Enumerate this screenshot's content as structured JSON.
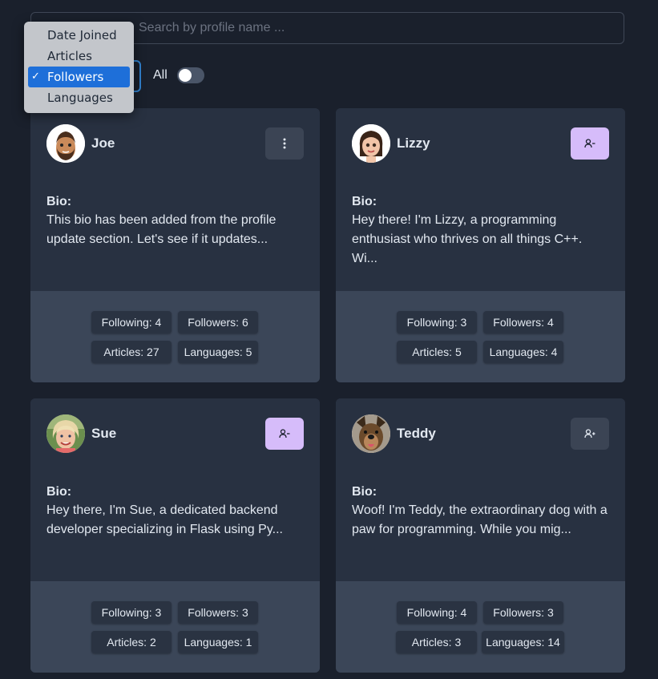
{
  "search": {
    "placeholder": "Search by profile name ...",
    "value": ""
  },
  "sort": {
    "options": [
      "Date Joined",
      "Articles",
      "Followers",
      "Languages"
    ],
    "selected_check": "✓"
  },
  "filter": {
    "toggle_label": "All"
  },
  "cards": [
    {
      "name": "Joe",
      "action": "menu",
      "bio_label": "Bio:",
      "bio": "This bio has been added from the profile update section. Let's see if it updates...",
      "following": "Following: 4",
      "followers": "Followers: 6",
      "articles": "Articles: 27",
      "languages": "Languages: 5"
    },
    {
      "name": "Lizzy",
      "action": "unfollow",
      "bio_label": "Bio:",
      "bio": "Hey there! I'm Lizzy, a programming enthusiast who thrives on all things C++. Wi...",
      "following": "Following: 3",
      "followers": "Followers: 4",
      "articles": "Articles: 5",
      "languages": "Languages: 4"
    },
    {
      "name": "Sue",
      "action": "unfollow",
      "bio_label": "Bio:",
      "bio": "Hey there, I'm Sue, a dedicated backend developer specializing in Flask using Py...",
      "following": "Following: 3",
      "followers": "Followers: 3",
      "articles": "Articles: 2",
      "languages": "Languages: 1"
    },
    {
      "name": "Teddy",
      "action": "follow",
      "bio_label": "Bio:",
      "bio": "Woof! I'm Teddy, the extraordinary dog with a paw for programming. While you mig...",
      "following": "Following: 4",
      "followers": "Followers: 3",
      "articles": "Articles: 3",
      "languages": "Languages: 14"
    }
  ],
  "colors": {
    "background": "#1a202c",
    "card": "#283141",
    "card_footer": "#3b4658",
    "unfollow_button": "#d6bcfa",
    "select_focus": "#3182ce",
    "dropdown_highlight": "#1e6fd9"
  }
}
